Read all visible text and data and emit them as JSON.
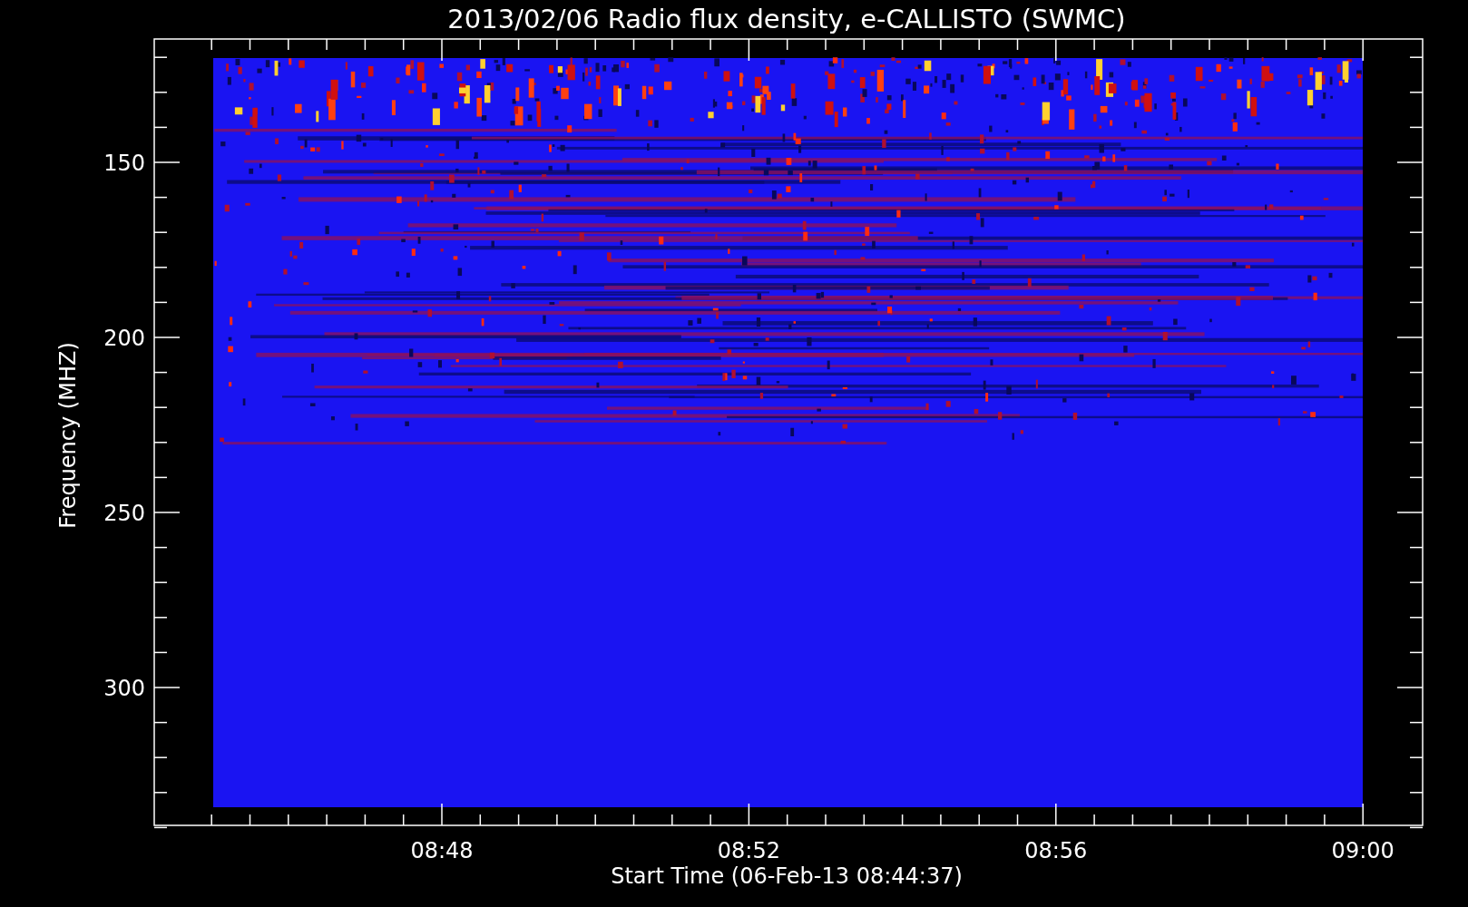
{
  "title": "2013/02/06  Radio flux density, e-CALLISTO (SWMC)",
  "y_axis": {
    "label": "Frequency (MHZ)",
    "ticks": [
      "150",
      "200",
      "250",
      "300"
    ]
  },
  "x_axis": {
    "label": "Start Time (06-Feb-13 08:44:37)",
    "ticks": [
      "08:48",
      "08:52",
      "08:56",
      "09:00"
    ]
  }
}
